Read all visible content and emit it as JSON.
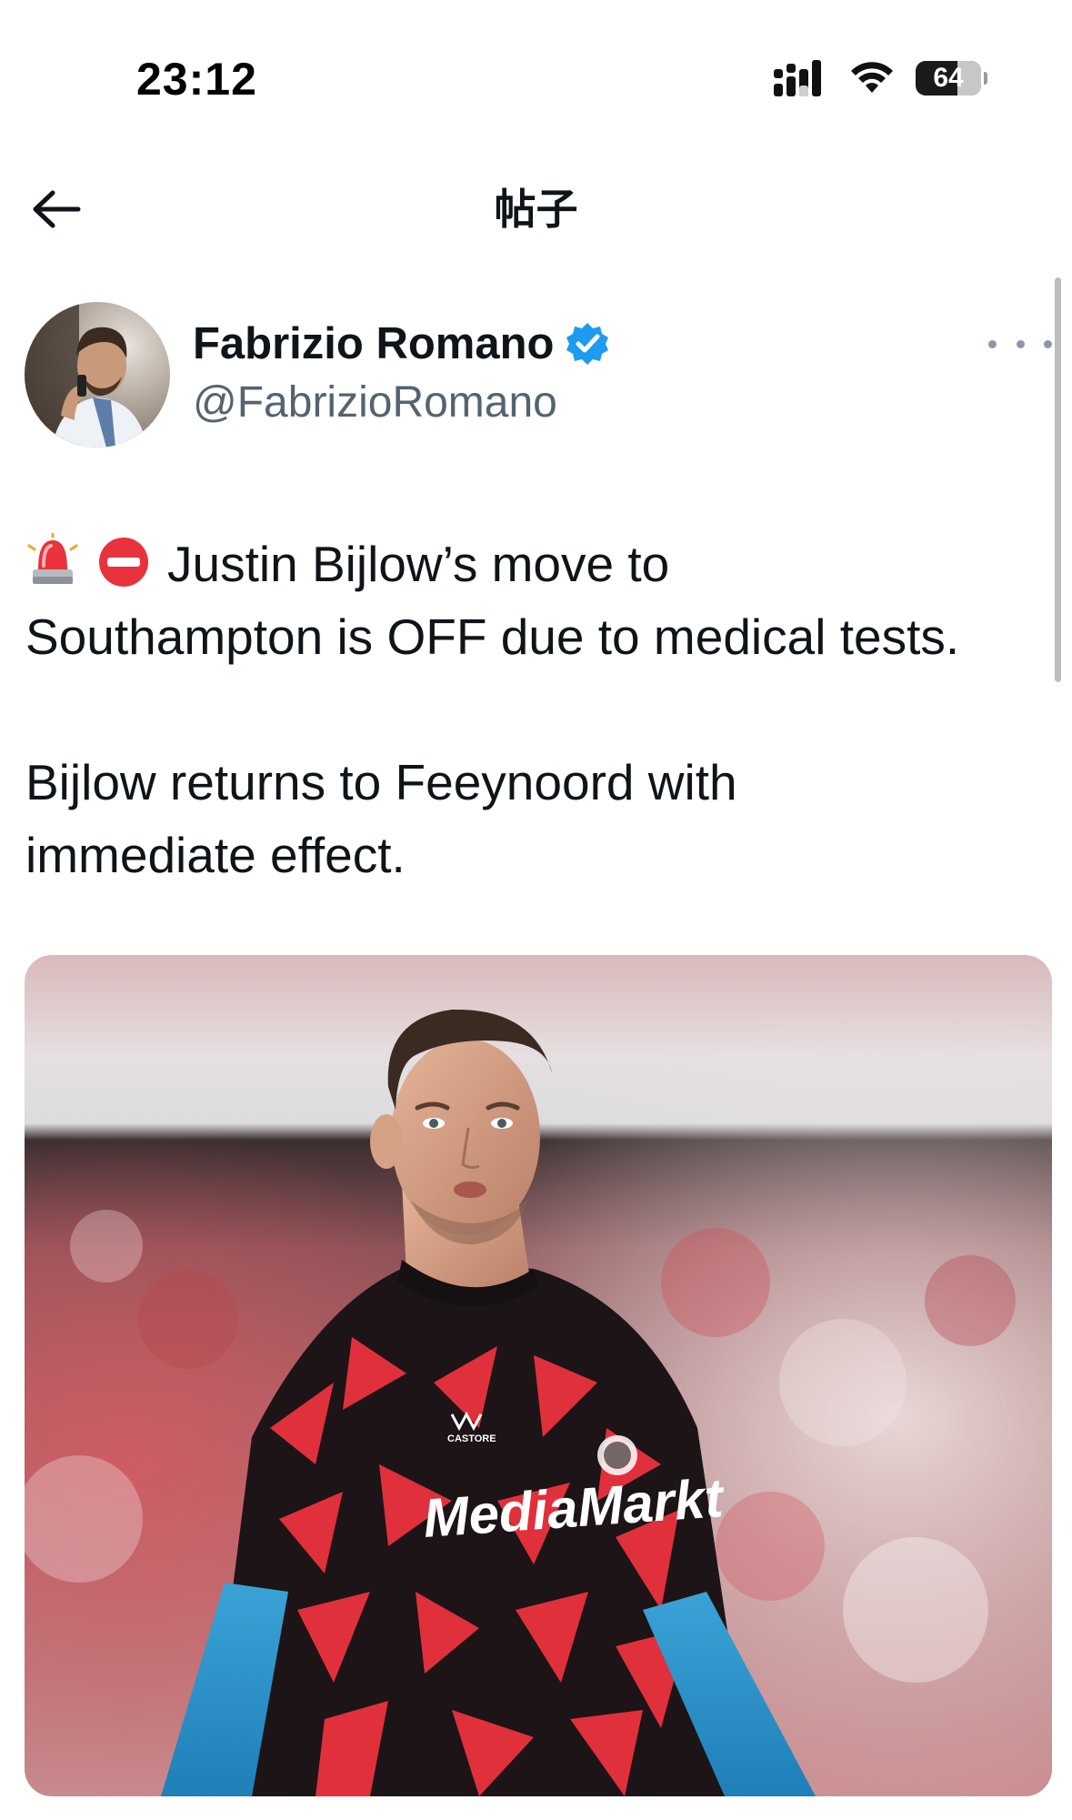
{
  "status_bar": {
    "time": "23:12",
    "battery": "64",
    "battery_fraction": 0.64
  },
  "nav": {
    "title": "帖子",
    "back_icon": "arrow-left-icon"
  },
  "author": {
    "name": "Fabrizio Romano",
    "handle": "@FabrizioRomano",
    "verified": true,
    "verified_color": "#1d9bf0"
  },
  "tweet": {
    "lines": [
      "Justin Bijlow’s move to",
      "Southampton is OFF due to medical tests.",
      "Bijlow returns to Feeynoord with",
      "immediate effect."
    ],
    "emojis": [
      "police-light-emoji",
      "no-entry-emoji"
    ]
  },
  "media": {
    "jersey_sponsor": "MediaMarkt",
    "kit_brand": "CASTORE"
  },
  "colors": {
    "text_primary": "#0f1419",
    "text_secondary": "#536471",
    "accent": "#1d9bf0"
  }
}
